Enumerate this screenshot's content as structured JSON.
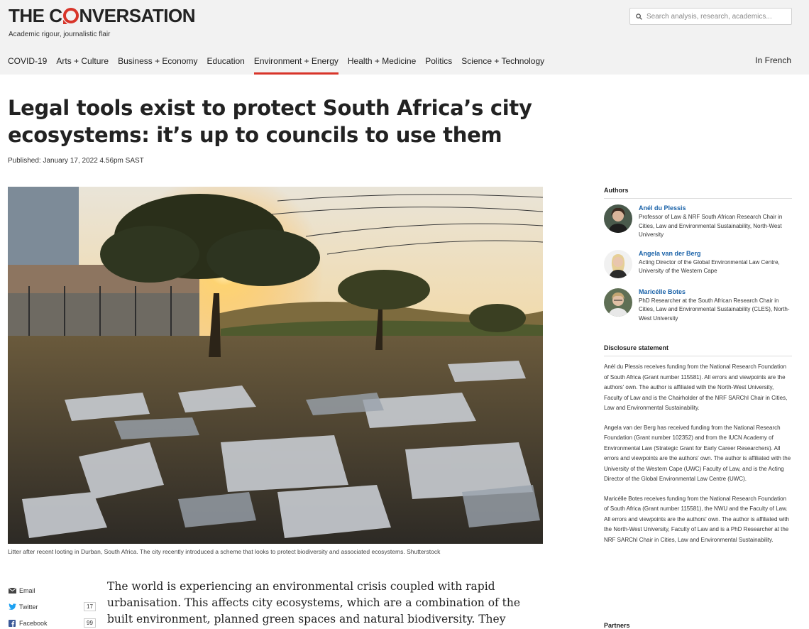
{
  "brand": {
    "logo_left": "THE C",
    "logo_right": "NVERSATION",
    "tagline": "Academic rigour, journalistic flair",
    "accent_color": "#d8352a",
    "link_color": "#1a62a8"
  },
  "search": {
    "placeholder": "Search analysis, research, academics..."
  },
  "nav": {
    "items": [
      {
        "label": "COVID-19"
      },
      {
        "label": "Arts + Culture"
      },
      {
        "label": "Business + Economy"
      },
      {
        "label": "Education"
      },
      {
        "label": "Environment + Energy",
        "active": true
      },
      {
        "label": "Health + Medicine"
      },
      {
        "label": "Politics"
      },
      {
        "label": "Science + Technology"
      }
    ],
    "right_label": "In French"
  },
  "article": {
    "headline": "Legal tools exist to protect South Africa’s city ecosystems: it’s up to councils to use them",
    "published": "Published: January 17, 2022 4.56pm SAST",
    "image_caption": "Litter after recent looting in Durban, South Africa. The city recently introduced a scheme that looks to protect biodiversity and associated ecosystems. Shutterstock",
    "body_text": "The world is experiencing an environmental crisis coupled with rapid urbanisation. This affects city ecosystems, which are a combination of the built environment, planned green spaces and natural biodiversity. They include streets,"
  },
  "share": {
    "items": [
      {
        "label": "Email",
        "icon": "email-icon",
        "count": ""
      },
      {
        "label": "Twitter",
        "icon": "twitter-icon",
        "count": "17"
      },
      {
        "label": "Facebook",
        "icon": "facebook-icon",
        "count": "99"
      }
    ]
  },
  "sidebar": {
    "authors_heading": "Authors",
    "authors": [
      {
        "name": "Anél du Plessis",
        "role": "Professor of Law & NRF South African Research Chair in Cities, Law and Environmental Sustainability, North-West University"
      },
      {
        "name": "Angela van der Berg",
        "role": "Acting Director of the Global Environmental Law Centre, University of the Western Cape"
      },
      {
        "name": "Maricélle Botes",
        "role": "PhD Researcher at the South African Research Chair in Cities, Law and Environmental Sustainability (CLES), North-West University"
      }
    ],
    "disclosure_heading": "Disclosure statement",
    "disclosure": [
      "Anél du Plessis receives funding from the National Research Foundation of South Africa (Grant number 115581). All errors and viewpoints are the authors' own. The author is affiliated with the North-West University, Faculty of Law and is the Chairholder of the NRF SARChI Chair in Cities, Law and Environmental Sustainability.",
      "Angela van der Berg has received funding from the National Research Foundation (Grant number 102352) and from the IUCN Academy of Environmental Law (Strategic Grant for Early Career Researchers). All errors and viewpoints are the authors' own. The author is affiliated with the University of the Western Cape (UWC) Faculty of Law, and is the Acting Director of the Global Environmental Law Centre (UWC).",
      "Maricélle Botes receives funding from the National Research Foundation of South Africa (Grant number 115581), the NWU and the Faculty of Law. All errors and viewpoints are the authors' own. The author is affiliated with the North-West University, Faculty of Law and is a PhD Researcher at the NRF SARChI Chair in Cities, Law and Environmental Sustainability."
    ],
    "partners_heading": "Partners"
  }
}
